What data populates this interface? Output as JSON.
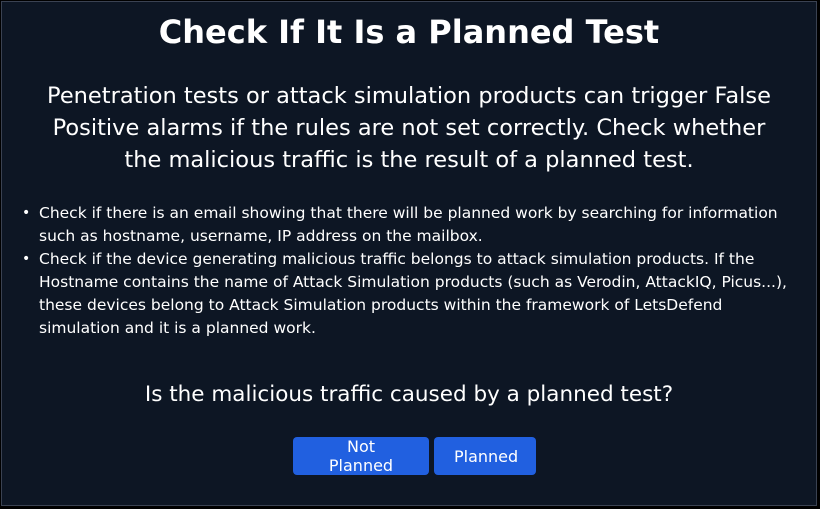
{
  "dialog": {
    "title": "Check If It Is a Planned Test",
    "description": "Penetration tests or attack simulation products can trigger False Positive alarms if the rules are not set correctly. Check whether the malicious traffic is the result of a planned test.",
    "guidance": [
      "Check if there is an email showing that there will be planned work by searching for information such as hostname, username, IP address on the mailbox.",
      "Check if the device generating malicious traffic belongs to attack simulation products. If the Hostname contains the name of Attack Simulation products (such as Verodin, AttackIQ, Picus...), these devices belong to Attack Simulation products within the framework of LetsDefend simulation and it is a planned work."
    ],
    "bullet_glyph": "•",
    "question": "Is the malicious traffic caused by a planned test?",
    "buttons": {
      "not_planned": "Not Planned",
      "planned": "Planned"
    }
  },
  "colors": {
    "background": "#0d1624",
    "border": "#3a4252",
    "text": "#ffffff",
    "button": "#2160e0"
  }
}
